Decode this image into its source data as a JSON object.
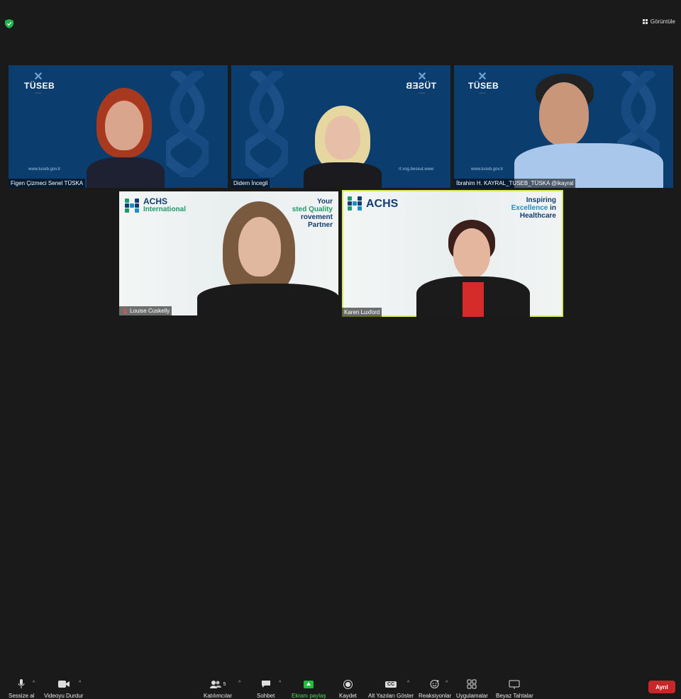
{
  "top_bar": {
    "view_label": "Görüntüle"
  },
  "participants": [
    {
      "name": "Figen Çizmeci Senel TÜSKA",
      "background": "tuseb"
    },
    {
      "name": "Didem İncegil",
      "background": "tuseb"
    },
    {
      "name": "İbrahim H. KAYRAL_TUSEB_TÜSKA @ikayral",
      "background": "tuseb"
    },
    {
      "name": "Louise Cuskelly",
      "background": "achs_international",
      "muted": true
    },
    {
      "name": "Karen Luxford",
      "background": "achs",
      "active_speaker": true
    }
  ],
  "tuseb_logo": {
    "text": "TÜSEB",
    "website": "www.tuseb.gov.tr",
    "website_mirrored": "rt.vog.beseut.www"
  },
  "achs_intl": {
    "logo_main": "ACHS",
    "logo_sub": "International",
    "tagline_1": "Your",
    "tagline_2a": "sted",
    "tagline_2b": "Quality",
    "tagline_3": "rovement",
    "tagline_4": "Partner"
  },
  "achs": {
    "logo_main": "ACHS",
    "tagline_1": "Inspiring",
    "tagline_2a": "Excellence",
    "tagline_2b": "in",
    "tagline_3": "Healthcare"
  },
  "toolbar": {
    "mute_label": "Sessize al",
    "video_label": "Videoyu Durdur",
    "participants_label": "Katılımcılar",
    "participants_count": "5",
    "chat_label": "Sohbet",
    "share_label": "Ekranı paylaş",
    "record_label": "Kaydet",
    "captions_label": "Alt Yazıları Göster",
    "captions_icon_text": "CC",
    "reactions_label": "Reaksiyonlar",
    "apps_label": "Uygulamalar",
    "whiteboard_label": "Beyaz Tahtalar",
    "end_label": "Ayrıl"
  },
  "colors": {
    "background": "#1a1a1a",
    "tuseb_blue": "#0b3d6e",
    "end_red": "#c6282a",
    "share_green": "#1fbf3b",
    "active_speaker": "#d7e95a"
  }
}
